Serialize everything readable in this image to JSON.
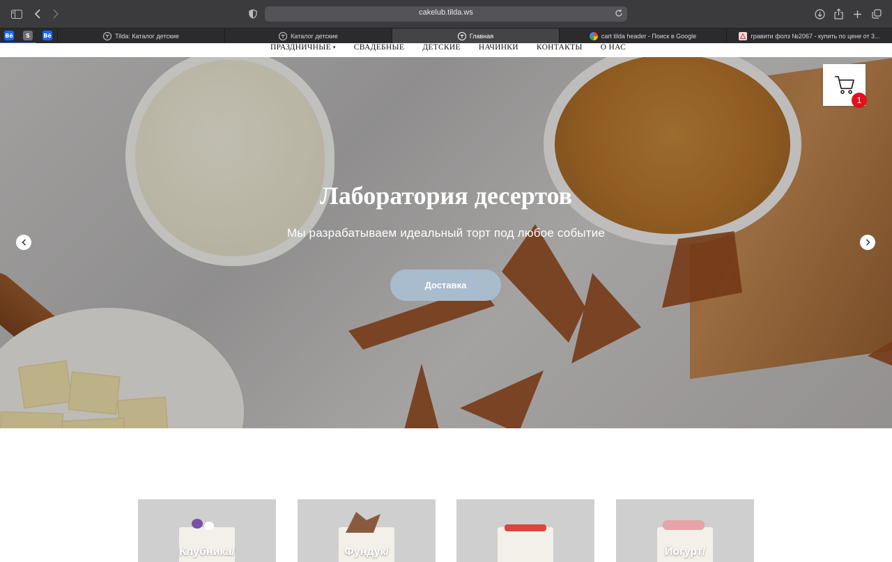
{
  "browser": {
    "url": "cakelub.tilda.ws",
    "pinned_tabs": [
      {
        "label": "Bē",
        "color": "#1769ff"
      },
      {
        "label": "S",
        "color": "#7b7b7f"
      },
      {
        "label": "Bē",
        "color": "#1769ff"
      }
    ],
    "tabs": [
      {
        "label": "Tilda: Каталог детские",
        "icon": "tilda-icon"
      },
      {
        "label": "Каталог детские",
        "icon": "tilda-icon"
      },
      {
        "label": "Главная",
        "icon": "tilda-icon",
        "active": true
      },
      {
        "label": "cart tilda header - Поиск в Google",
        "icon": "google-icon"
      },
      {
        "label": "гравити фолз №2067 - купить по цене от 3...",
        "icon": "store-icon"
      }
    ]
  },
  "nav": {
    "items": [
      "ПРАЗДНИЧНЫЕ",
      "СВАДЕБНЫЕ",
      "ДЕТСКИЕ",
      "НАЧИНКИ",
      "КОНТАКТЫ",
      "О НАС"
    ],
    "dropdown_caret": "▾"
  },
  "hero": {
    "title": "Лаборатория десертов",
    "subtitle": "Мы разрабатываем идеальный торт под любое событие",
    "button": "Доставка",
    "button_color": "#a8bccd"
  },
  "cart": {
    "count": "1",
    "badge_color": "#e2111b",
    "icon": "cart-icon"
  },
  "products": [
    {
      "label": "Клубника/"
    },
    {
      "label": "Фундук/"
    },
    {
      "label": ""
    },
    {
      "label": "Йогурт/"
    }
  ]
}
